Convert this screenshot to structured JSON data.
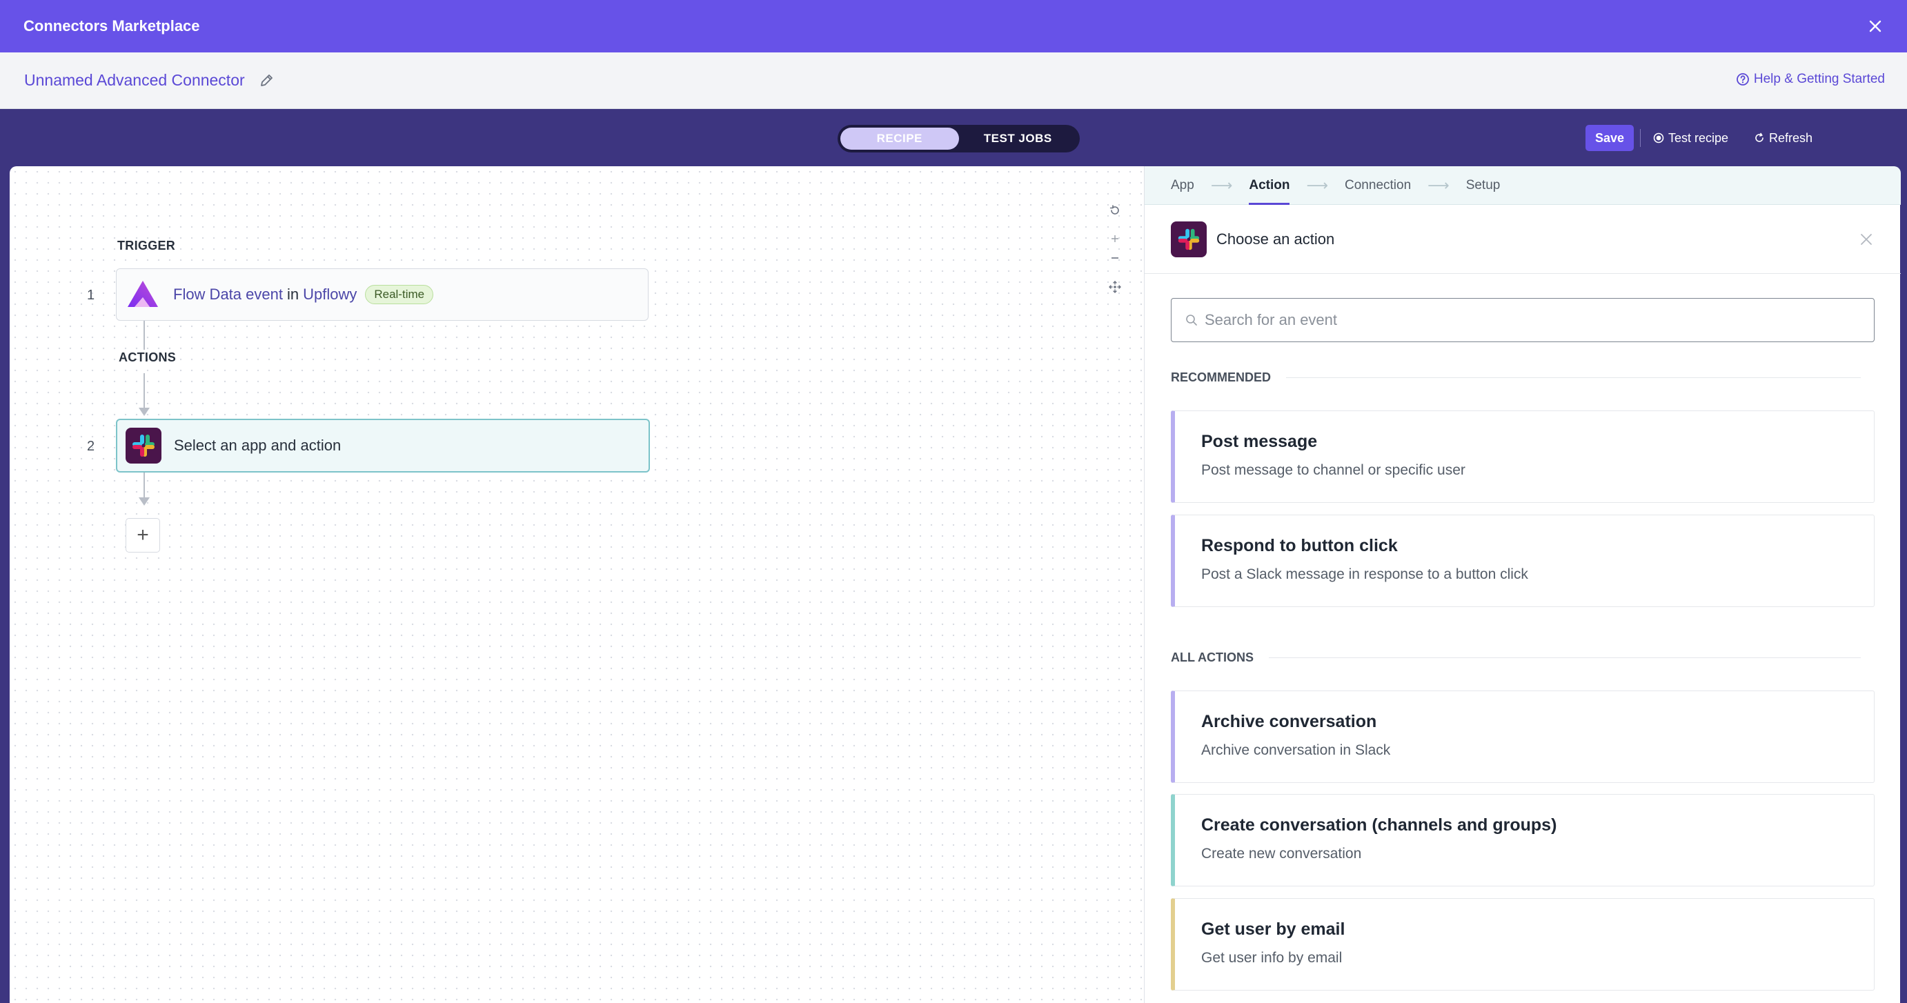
{
  "topbar": {
    "title": "Connectors Marketplace"
  },
  "subheader": {
    "connector_name": "Unnamed Advanced Connector",
    "help_label": "Help & Getting Started"
  },
  "toolbar": {
    "tab_recipe": "RECIPE",
    "tab_test_jobs": "TEST JOBS",
    "save_label": "Save",
    "test_recipe_label": "Test recipe",
    "refresh_label": "Refresh"
  },
  "canvas": {
    "trigger_label": "TRIGGER",
    "actions_label": "ACTIONS",
    "step1": {
      "number": "1",
      "event": "Flow Data event",
      "in_word": "in",
      "app": "Upflowy",
      "badge": "Real-time"
    },
    "step2": {
      "number": "2",
      "text": "Select an app and action"
    },
    "add_symbol": "+"
  },
  "panel": {
    "nav": [
      "App",
      "Action",
      "Connection",
      "Setup"
    ],
    "nav_active_index": 1,
    "title": "Choose an action",
    "search_placeholder": "Search for an event",
    "recommended_label": "RECOMMENDED",
    "all_actions_label": "ALL ACTIONS",
    "recommended": [
      {
        "title": "Post message",
        "desc": "Post message to channel or specific user",
        "accent": "#b8aef0"
      },
      {
        "title": "Respond to button click",
        "desc": "Post a Slack message in response to a button click",
        "accent": "#b8aef0"
      }
    ],
    "all_actions": [
      {
        "title": "Archive conversation",
        "desc": "Archive conversation in Slack",
        "accent": "#b8aef0"
      },
      {
        "title": "Create conversation (channels and groups)",
        "desc": "Create new conversation",
        "accent": "#8fd3cd"
      },
      {
        "title": "Get user by email",
        "desc": "Get user info by email",
        "accent": "#e3cf8f"
      }
    ]
  },
  "colors": {
    "brand": "#6752e8",
    "band": "#3d3580",
    "link": "#5a48d6"
  },
  "icons": [
    "close-icon",
    "pencil-icon",
    "help-circle-icon",
    "record-icon",
    "refresh-icon",
    "upflowy-logo-icon",
    "slack-logo-icon",
    "search-icon",
    "reset-icon",
    "zoom-in-icon",
    "zoom-out-icon",
    "fit-icon",
    "arrow-right-icon"
  ]
}
